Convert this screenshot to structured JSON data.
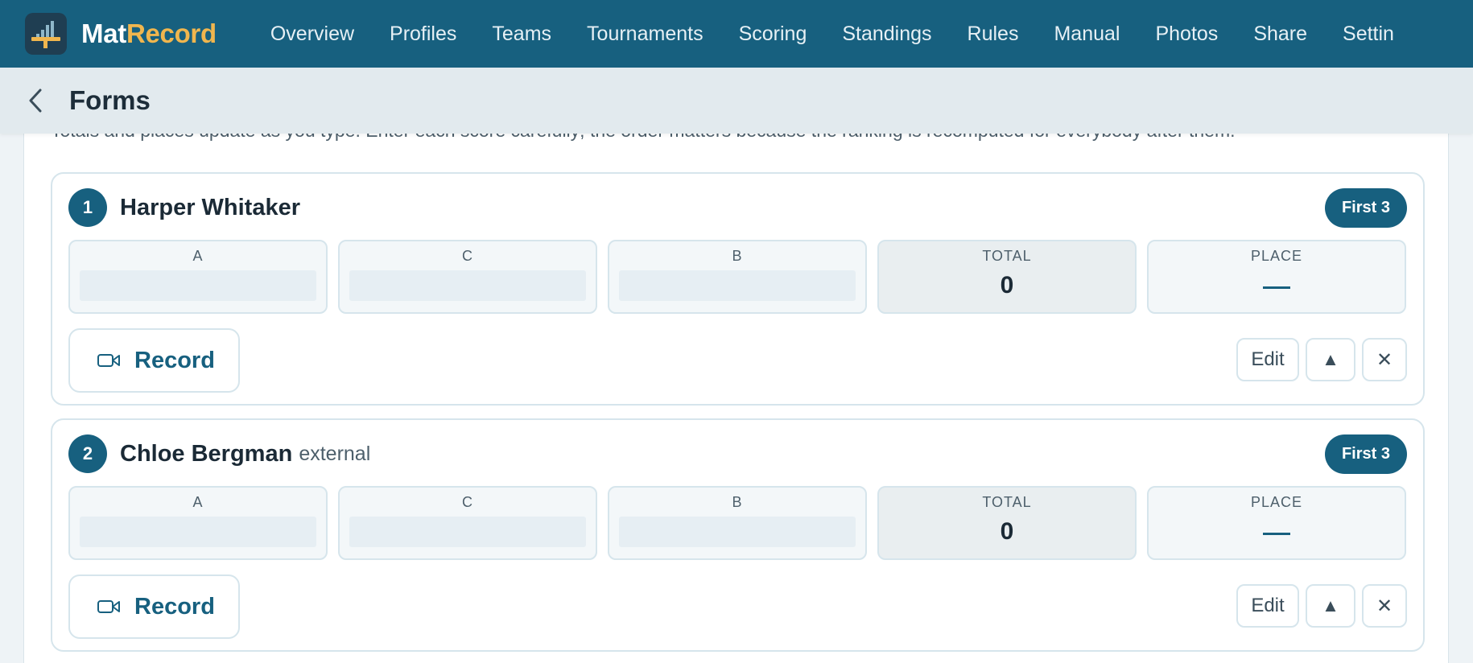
{
  "app": {
    "name_part1": "Mat",
    "name_part2": "Record",
    "brand_color": "#17607f",
    "accent_color": "#f0b64e"
  },
  "nav": {
    "items": [
      "Overview",
      "Profiles",
      "Teams",
      "Tournaments",
      "Scoring",
      "Standings",
      "Rules",
      "Manual",
      "Photos",
      "Share",
      "Settin"
    ]
  },
  "header": {
    "back_icon": "chevron-left-icon",
    "title": "Forms"
  },
  "intro": {
    "text": "Totals and places update as you type. Enter each score carefully; the order matters because the ranking is recomputed for everybody after them."
  },
  "entries": [
    {
      "number": "1",
      "name": "Harper Whitaker",
      "tag": "",
      "pill": "First 3",
      "scores": [
        {
          "label": "A",
          "value": ""
        },
        {
          "label": "C",
          "value": ""
        },
        {
          "label": "B",
          "value": ""
        }
      ],
      "total_label": "TOTAL",
      "total_value": "0",
      "place_label": "PLACE",
      "place_value": "—",
      "record_label": "Record",
      "record_icon": "video-camera-icon",
      "edit_label": "Edit",
      "up_label": "▲",
      "remove_label": "✕"
    },
    {
      "number": "2",
      "name": "Chloe Bergman",
      "tag": "external",
      "pill": "First 3",
      "scores": [
        {
          "label": "A",
          "value": ""
        },
        {
          "label": "C",
          "value": ""
        },
        {
          "label": "B",
          "value": ""
        }
      ],
      "total_label": "TOTAL",
      "total_value": "0",
      "place_label": "PLACE",
      "place_value": "—",
      "record_label": "Record",
      "record_icon": "video-camera-icon",
      "edit_label": "Edit",
      "up_label": "▲",
      "remove_label": "✕"
    }
  ]
}
